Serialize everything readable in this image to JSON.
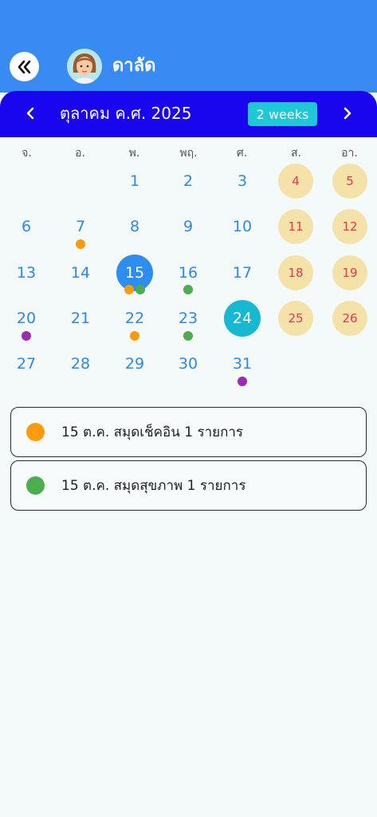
{
  "header": {
    "user_name": "ดาลัด",
    "background_color": "#388bf2",
    "back_icon": "double-chevron-left-icon"
  },
  "calendar": {
    "month_title": "ตุลาคม ค.ศ. 2025",
    "view_toggle": "2 weeks",
    "header_color": "#1a05ef",
    "weekdays": [
      "จ.",
      "อ.",
      "พ.",
      "พฤ.",
      "ศ.",
      "ส.",
      "อา."
    ],
    "days": {
      "d1": "1",
      "d2": "2",
      "d3": "3",
      "d4": "4",
      "d5": "5",
      "d6": "6",
      "d7": "7",
      "d8": "8",
      "d9": "9",
      "d10": "10",
      "d11": "11",
      "d12": "12",
      "d13": "13",
      "d14": "14",
      "d15": "15",
      "d16": "16",
      "d17": "17",
      "d18": "18",
      "d19": "19",
      "d20": "20",
      "d21": "21",
      "d22": "22",
      "d23": "23",
      "d24": "24",
      "d25": "25",
      "d26": "26",
      "d27": "27",
      "d28": "28",
      "d29": "29",
      "d30": "30",
      "d31": "31"
    },
    "selected_day": "15",
    "today": "24",
    "event_colors": {
      "checkin": "#ff9a0d",
      "health": "#4cae4f",
      "other": "#9c2cb0"
    }
  },
  "events": [
    {
      "date": "15 ต.ค.",
      "text": "15 ต.ค.  สมุดเช็คอิน 1 รายการ",
      "color": "#ff9a0d"
    },
    {
      "date": "15 ต.ค.",
      "text": "15 ต.ค.  สมุดสุขภาพ 1 รายการ",
      "color": "#4cae4f"
    }
  ]
}
